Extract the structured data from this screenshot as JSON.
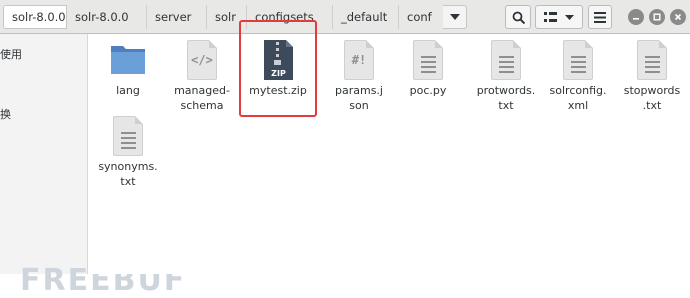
{
  "breadcrumb": {
    "segments": [
      "solr-8.0.0",
      "solr-8.0.0",
      "server",
      "solr",
      "configsets",
      "_default",
      "conf"
    ]
  },
  "sidebar": {
    "labels": [
      "使用",
      "换"
    ]
  },
  "files": [
    {
      "name": "lang",
      "icon": "folder-icon"
    },
    {
      "name": "managed-schema",
      "icon": "code-file-icon"
    },
    {
      "name": "mytest.zip",
      "icon": "zip-archive-icon"
    },
    {
      "name": "params.json",
      "icon": "script-file-icon"
    },
    {
      "name": "poc.py",
      "icon": "text-file-icon"
    },
    {
      "name": "protwords.txt",
      "icon": "text-file-icon"
    },
    {
      "name": "solrconfig.xml",
      "icon": "text-file-icon"
    },
    {
      "name": "stopwords.txt",
      "icon": "text-file-icon"
    },
    {
      "name": "synonyms.txt",
      "icon": "text-file-icon"
    }
  ],
  "icons": {
    "folder_color": "#5d8fc9",
    "zip_color": "#3d4a5c",
    "highlight_color": "#e33b3b"
  },
  "watermark": "FREEBUF",
  "zip_label": "ZIP",
  "code_glyph": "</>",
  "script_glyph": "#!"
}
